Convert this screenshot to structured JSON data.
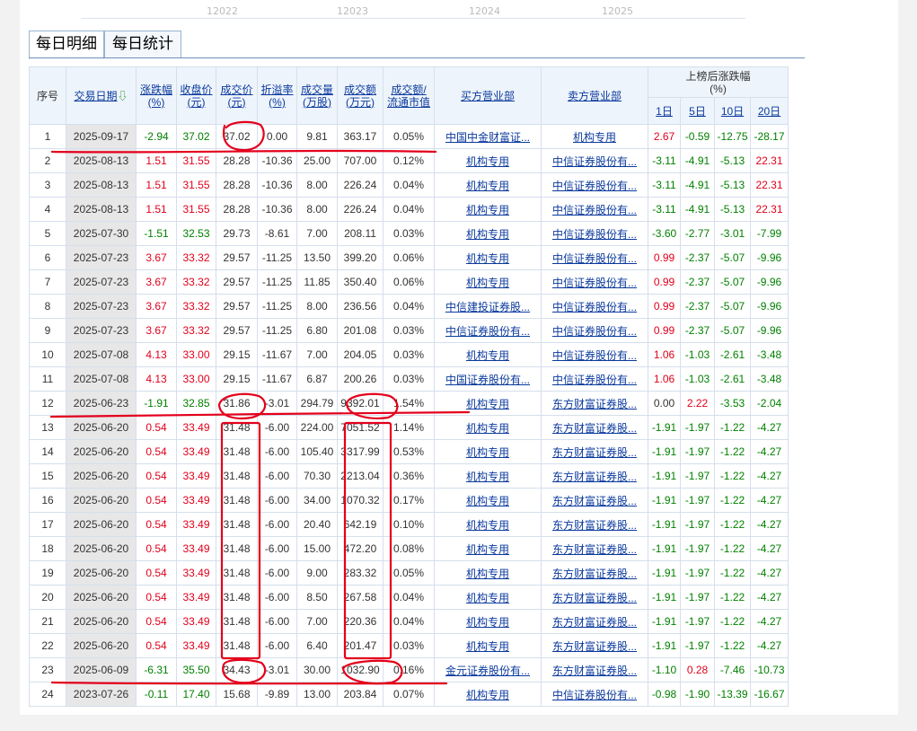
{
  "top_axis_labels": [
    "12022",
    "12023",
    "12024",
    "12025"
  ],
  "tabs": [
    {
      "label": "每日明细",
      "active": true
    },
    {
      "label": "每日统计",
      "active": false
    }
  ],
  "headers": {
    "index": "序号",
    "date": "交易日期",
    "change": "涨跌幅",
    "change_unit": "(%)",
    "close": "收盘价",
    "close_unit": "(元)",
    "price": "成交价",
    "price_unit": "(元)",
    "premium": "折溢率",
    "premium_unit": "(%)",
    "volume": "成交量",
    "volume_unit": "(万股)",
    "amount": "成交额",
    "amount_unit": "(万元)",
    "ratio": "成交额/",
    "ratio_unit": "流通市值",
    "buyer": "买方营业部",
    "seller": "卖方营业部",
    "after": "上榜后涨跌幅",
    "after_unit": "(%)",
    "d1": "1日",
    "d5": "5日",
    "d10": "10日",
    "d20": "20日"
  },
  "colors": {
    "up": "#e0001b",
    "down": "#008000",
    "link": "#0b3a9d",
    "annotation": "#e3001b"
  },
  "rows": [
    {
      "idx": "1",
      "date": "2025-09-17",
      "chg": "-2.94",
      "close": "37.02",
      "price": "37.02",
      "prem": "0.00",
      "vol": "9.81",
      "amt": "363.17",
      "ratio": "0.05%",
      "buyer": "中国中金财富证...",
      "seller": "机构专用",
      "d1": "2.67",
      "d5": "-0.59",
      "d10": "-12.75",
      "d20": "-28.17"
    },
    {
      "idx": "2",
      "date": "2025-08-13",
      "chg": "1.51",
      "close": "31.55",
      "price": "28.28",
      "prem": "-10.36",
      "vol": "25.00",
      "amt": "707.00",
      "ratio": "0.12%",
      "buyer": "机构专用",
      "seller": "中信证券股份有...",
      "d1": "-3.11",
      "d5": "-4.91",
      "d10": "-5.13",
      "d20": "22.31"
    },
    {
      "idx": "3",
      "date": "2025-08-13",
      "chg": "1.51",
      "close": "31.55",
      "price": "28.28",
      "prem": "-10.36",
      "vol": "8.00",
      "amt": "226.24",
      "ratio": "0.04%",
      "buyer": "机构专用",
      "seller": "中信证券股份有...",
      "d1": "-3.11",
      "d5": "-4.91",
      "d10": "-5.13",
      "d20": "22.31"
    },
    {
      "idx": "4",
      "date": "2025-08-13",
      "chg": "1.51",
      "close": "31.55",
      "price": "28.28",
      "prem": "-10.36",
      "vol": "8.00",
      "amt": "226.24",
      "ratio": "0.04%",
      "buyer": "机构专用",
      "seller": "中信证券股份有...",
      "d1": "-3.11",
      "d5": "-4.91",
      "d10": "-5.13",
      "d20": "22.31"
    },
    {
      "idx": "5",
      "date": "2025-07-30",
      "chg": "-1.51",
      "close": "32.53",
      "price": "29.73",
      "prem": "-8.61",
      "vol": "7.00",
      "amt": "208.11",
      "ratio": "0.03%",
      "buyer": "机构专用",
      "seller": "中信证券股份有...",
      "d1": "-3.60",
      "d5": "-2.77",
      "d10": "-3.01",
      "d20": "-7.99"
    },
    {
      "idx": "6",
      "date": "2025-07-23",
      "chg": "3.67",
      "close": "33.32",
      "price": "29.57",
      "prem": "-11.25",
      "vol": "13.50",
      "amt": "399.20",
      "ratio": "0.06%",
      "buyer": "机构专用",
      "seller": "中信证券股份有...",
      "d1": "0.99",
      "d5": "-2.37",
      "d10": "-5.07",
      "d20": "-9.96"
    },
    {
      "idx": "7",
      "date": "2025-07-23",
      "chg": "3.67",
      "close": "33.32",
      "price": "29.57",
      "prem": "-11.25",
      "vol": "11.85",
      "amt": "350.40",
      "ratio": "0.06%",
      "buyer": "机构专用",
      "seller": "中信证券股份有...",
      "d1": "0.99",
      "d5": "-2.37",
      "d10": "-5.07",
      "d20": "-9.96"
    },
    {
      "idx": "8",
      "date": "2025-07-23",
      "chg": "3.67",
      "close": "33.32",
      "price": "29.57",
      "prem": "-11.25",
      "vol": "8.00",
      "amt": "236.56",
      "ratio": "0.04%",
      "buyer": "中信建投证券股...",
      "seller": "中信证券股份有...",
      "d1": "0.99",
      "d5": "-2.37",
      "d10": "-5.07",
      "d20": "-9.96"
    },
    {
      "idx": "9",
      "date": "2025-07-23",
      "chg": "3.67",
      "close": "33.32",
      "price": "29.57",
      "prem": "-11.25",
      "vol": "6.80",
      "amt": "201.08",
      "ratio": "0.03%",
      "buyer": "中信证券股份有...",
      "seller": "中信证券股份有...",
      "d1": "0.99",
      "d5": "-2.37",
      "d10": "-5.07",
      "d20": "-9.96"
    },
    {
      "idx": "10",
      "date": "2025-07-08",
      "chg": "4.13",
      "close": "33.00",
      "price": "29.15",
      "prem": "-11.67",
      "vol": "7.00",
      "amt": "204.05",
      "ratio": "0.03%",
      "buyer": "机构专用",
      "seller": "中信证券股份有...",
      "d1": "1.06",
      "d5": "-1.03",
      "d10": "-2.61",
      "d20": "-3.48"
    },
    {
      "idx": "11",
      "date": "2025-07-08",
      "chg": "4.13",
      "close": "33.00",
      "price": "29.15",
      "prem": "-11.67",
      "vol": "6.87",
      "amt": "200.26",
      "ratio": "0.03%",
      "buyer": "中国证券股份有...",
      "seller": "中信证券股份有...",
      "d1": "1.06",
      "d5": "-1.03",
      "d10": "-2.61",
      "d20": "-3.48"
    },
    {
      "idx": "12",
      "date": "2025-06-23",
      "chg": "-1.91",
      "close": "32.85",
      "price": "31.86",
      "prem": "-3.01",
      "vol": "294.79",
      "amt": "9392.01",
      "ratio": "1.54%",
      "buyer": "机构专用",
      "seller": "东方财富证券股...",
      "d1": "0.00",
      "d5": "2.22",
      "d10": "-3.53",
      "d20": "-2.04"
    },
    {
      "idx": "13",
      "date": "2025-06-20",
      "chg": "0.54",
      "close": "33.49",
      "price": "31.48",
      "prem": "-6.00",
      "vol": "224.00",
      "amt": "7051.52",
      "ratio": "1.14%",
      "buyer": "机构专用",
      "seller": "东方财富证券股...",
      "d1": "-1.91",
      "d5": "-1.97",
      "d10": "-1.22",
      "d20": "-4.27"
    },
    {
      "idx": "14",
      "date": "2025-06-20",
      "chg": "0.54",
      "close": "33.49",
      "price": "31.48",
      "prem": "-6.00",
      "vol": "105.40",
      "amt": "3317.99",
      "ratio": "0.53%",
      "buyer": "机构专用",
      "seller": "东方财富证券股...",
      "d1": "-1.91",
      "d5": "-1.97",
      "d10": "-1.22",
      "d20": "-4.27"
    },
    {
      "idx": "15",
      "date": "2025-06-20",
      "chg": "0.54",
      "close": "33.49",
      "price": "31.48",
      "prem": "-6.00",
      "vol": "70.30",
      "amt": "2213.04",
      "ratio": "0.36%",
      "buyer": "机构专用",
      "seller": "东方财富证券股...",
      "d1": "-1.91",
      "d5": "-1.97",
      "d10": "-1.22",
      "d20": "-4.27"
    },
    {
      "idx": "16",
      "date": "2025-06-20",
      "chg": "0.54",
      "close": "33.49",
      "price": "31.48",
      "prem": "-6.00",
      "vol": "34.00",
      "amt": "1070.32",
      "ratio": "0.17%",
      "buyer": "机构专用",
      "seller": "东方财富证券股...",
      "d1": "-1.91",
      "d5": "-1.97",
      "d10": "-1.22",
      "d20": "-4.27"
    },
    {
      "idx": "17",
      "date": "2025-06-20",
      "chg": "0.54",
      "close": "33.49",
      "price": "31.48",
      "prem": "-6.00",
      "vol": "20.40",
      "amt": "642.19",
      "ratio": "0.10%",
      "buyer": "机构专用",
      "seller": "东方财富证券股...",
      "d1": "-1.91",
      "d5": "-1.97",
      "d10": "-1.22",
      "d20": "-4.27"
    },
    {
      "idx": "18",
      "date": "2025-06-20",
      "chg": "0.54",
      "close": "33.49",
      "price": "31.48",
      "prem": "-6.00",
      "vol": "15.00",
      "amt": "472.20",
      "ratio": "0.08%",
      "buyer": "机构专用",
      "seller": "东方财富证券股...",
      "d1": "-1.91",
      "d5": "-1.97",
      "d10": "-1.22",
      "d20": "-4.27"
    },
    {
      "idx": "19",
      "date": "2025-06-20",
      "chg": "0.54",
      "close": "33.49",
      "price": "31.48",
      "prem": "-6.00",
      "vol": "9.00",
      "amt": "283.32",
      "ratio": "0.05%",
      "buyer": "机构专用",
      "seller": "东方财富证券股...",
      "d1": "-1.91",
      "d5": "-1.97",
      "d10": "-1.22",
      "d20": "-4.27"
    },
    {
      "idx": "20",
      "date": "2025-06-20",
      "chg": "0.54",
      "close": "33.49",
      "price": "31.48",
      "prem": "-6.00",
      "vol": "8.50",
      "amt": "267.58",
      "ratio": "0.04%",
      "buyer": "机构专用",
      "seller": "东方财富证券股...",
      "d1": "-1.91",
      "d5": "-1.97",
      "d10": "-1.22",
      "d20": "-4.27"
    },
    {
      "idx": "21",
      "date": "2025-06-20",
      "chg": "0.54",
      "close": "33.49",
      "price": "31.48",
      "prem": "-6.00",
      "vol": "7.00",
      "amt": "220.36",
      "ratio": "0.04%",
      "buyer": "机构专用",
      "seller": "东方财富证券股...",
      "d1": "-1.91",
      "d5": "-1.97",
      "d10": "-1.22",
      "d20": "-4.27"
    },
    {
      "idx": "22",
      "date": "2025-06-20",
      "chg": "0.54",
      "close": "33.49",
      "price": "31.48",
      "prem": "-6.00",
      "vol": "6.40",
      "amt": "201.47",
      "ratio": "0.03%",
      "buyer": "机构专用",
      "seller": "东方财富证券股...",
      "d1": "-1.91",
      "d5": "-1.97",
      "d10": "-1.22",
      "d20": "-4.27"
    },
    {
      "idx": "23",
      "date": "2025-06-09",
      "chg": "-6.31",
      "close": "35.50",
      "price": "34.43",
      "prem": "-3.01",
      "vol": "30.00",
      "amt": "1032.90",
      "ratio": "0.16%",
      "buyer": "金元证券股份有...",
      "seller": "东方财富证券股...",
      "d1": "-1.10",
      "d5": "0.28",
      "d10": "-7.46",
      "d20": "-10.73"
    },
    {
      "idx": "24",
      "date": "2023-07-26",
      "chg": "-0.11",
      "close": "17.40",
      "price": "15.68",
      "prem": "-9.89",
      "vol": "13.00",
      "amt": "203.84",
      "ratio": "0.07%",
      "buyer": "机构专用",
      "seller": "中信证券股份有...",
      "d1": "-0.98",
      "d5": "-1.90",
      "d10": "-13.39",
      "d20": "-16.67"
    }
  ]
}
